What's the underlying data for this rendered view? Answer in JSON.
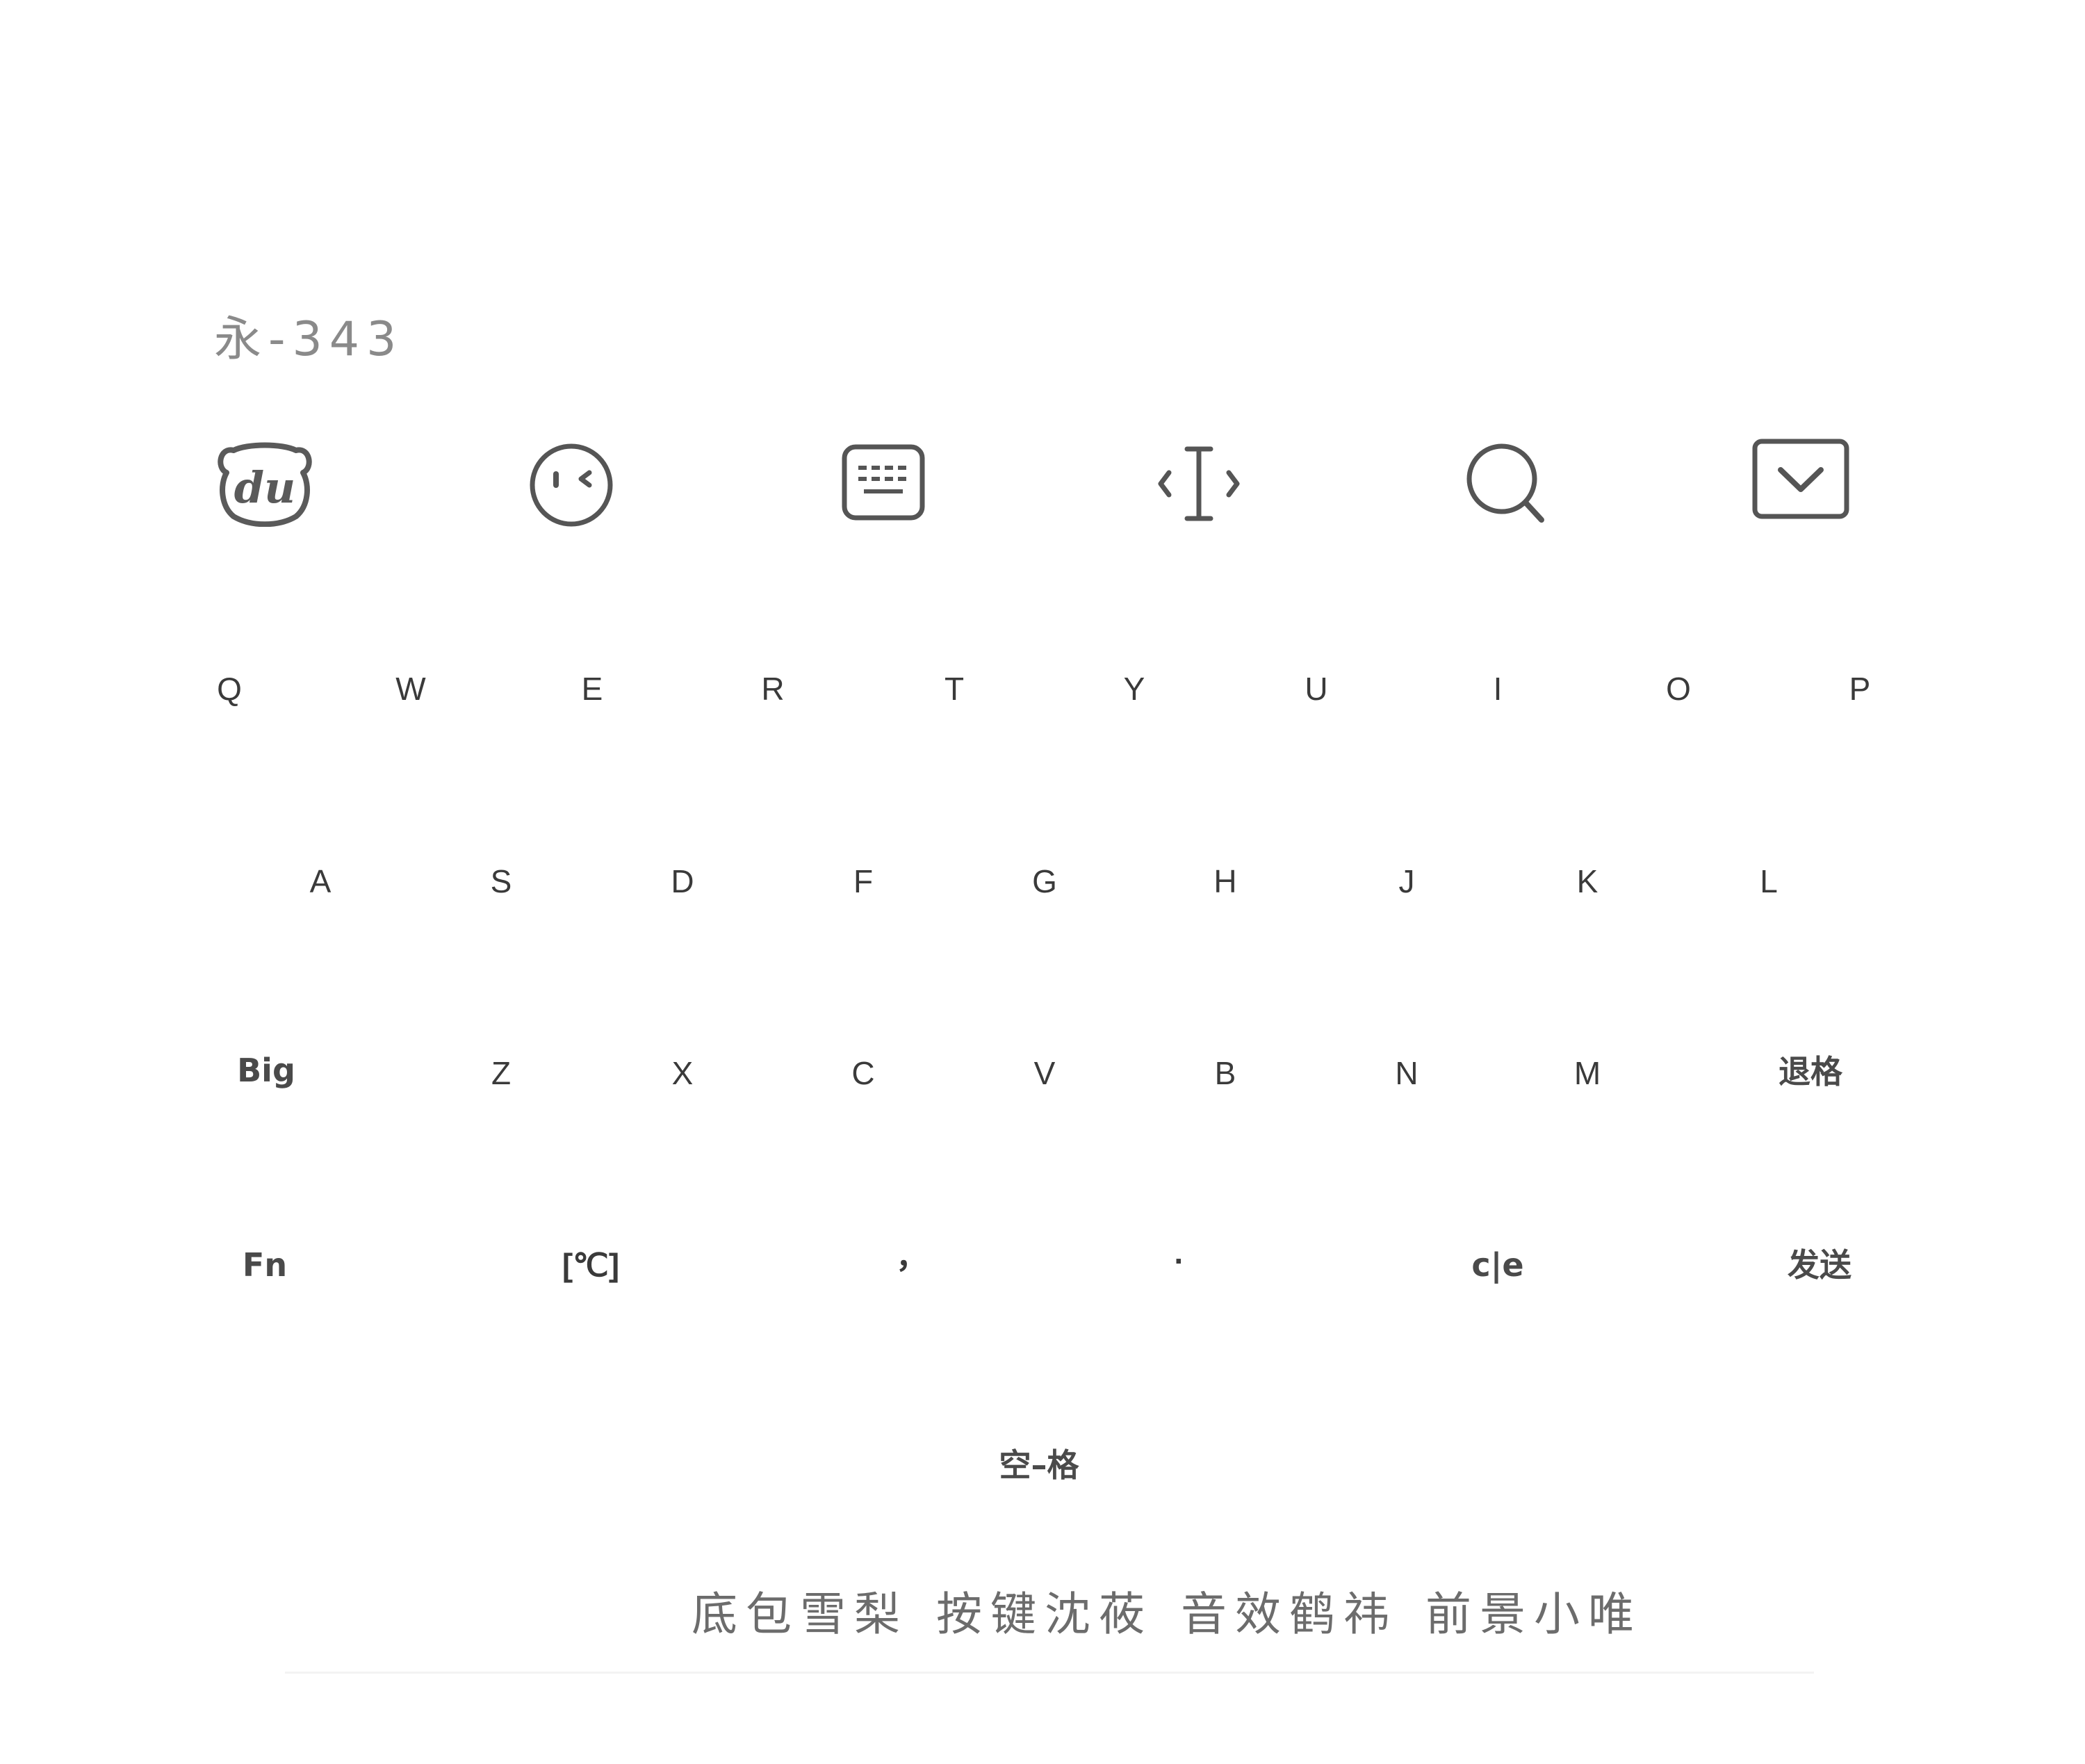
{
  "skin_name": "永-343",
  "toolbar": {
    "icons": [
      "du-bear-logo-icon",
      "emoji-face-icon",
      "keyboard-icon",
      "cursor-move-icon",
      "search-icon",
      "collapse-keyboard-icon"
    ]
  },
  "keyboard": {
    "row1": [
      "Q",
      "W",
      "E",
      "R",
      "T",
      "Y",
      "U",
      "I",
      "O",
      "P"
    ],
    "row2": [
      "A",
      "S",
      "D",
      "F",
      "G",
      "H",
      "J",
      "K",
      "L"
    ],
    "row3": [
      "Big",
      "Z",
      "X",
      "C",
      "V",
      "B",
      "N",
      "M",
      "退格"
    ],
    "row4": [
      "Fn",
      "[℃]",
      "，",
      "·",
      "c|e",
      "发送"
    ],
    "space": "空–格"
  },
  "credits": [
    "底包雪梨",
    "按键沈莜",
    "音效鹤祎",
    "前景小唯"
  ],
  "colors": {
    "key_text": "#3a3a3a",
    "icon_stroke": "#555555",
    "subtitle": "#8a8a8a"
  }
}
